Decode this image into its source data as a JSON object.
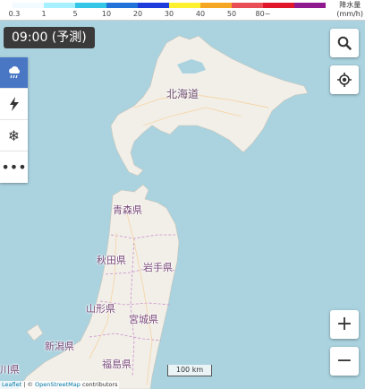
{
  "legend": {
    "title_line1": "降水量",
    "title_line2": "(mm/h)",
    "colors": [
      "#f2fbff",
      "#a6f0ff",
      "#33c6e6",
      "#2173d9",
      "#1e3cdc",
      "#fff130",
      "#f5a623",
      "#e94e57",
      "#e0162b",
      "#8f1a8f"
    ],
    "ticks": [
      "0.3",
      "1",
      "5",
      "10",
      "20",
      "30",
      "40",
      "50",
      "80~"
    ]
  },
  "time_label": "09:00 (予測)",
  "side_tools": [
    {
      "name": "rain",
      "icon": "cloud-rain-icon",
      "active": true
    },
    {
      "name": "lightning",
      "icon": "lightning-icon",
      "active": false
    },
    {
      "name": "snow",
      "icon": "snowflake-icon",
      "active": false
    },
    {
      "name": "more",
      "icon": "more-icon",
      "active": false,
      "label": "•••"
    }
  ],
  "map_labels": {
    "hokkaido": "北海道",
    "aomori": "青森県",
    "akita": "秋田県",
    "iwate": "岩手県",
    "yamagata": "山形県",
    "miyagi": "宮城県",
    "niigata": "新潟県",
    "fukushima": "福島県",
    "partial": "川県"
  },
  "scale_label": "100 km",
  "attribution": {
    "leaflet": "Leaflet",
    "sep": " | © ",
    "osm": "OpenStreetMap",
    "contributors": " contributors"
  },
  "controls": {
    "zoom_in": "+",
    "zoom_out": "−"
  }
}
